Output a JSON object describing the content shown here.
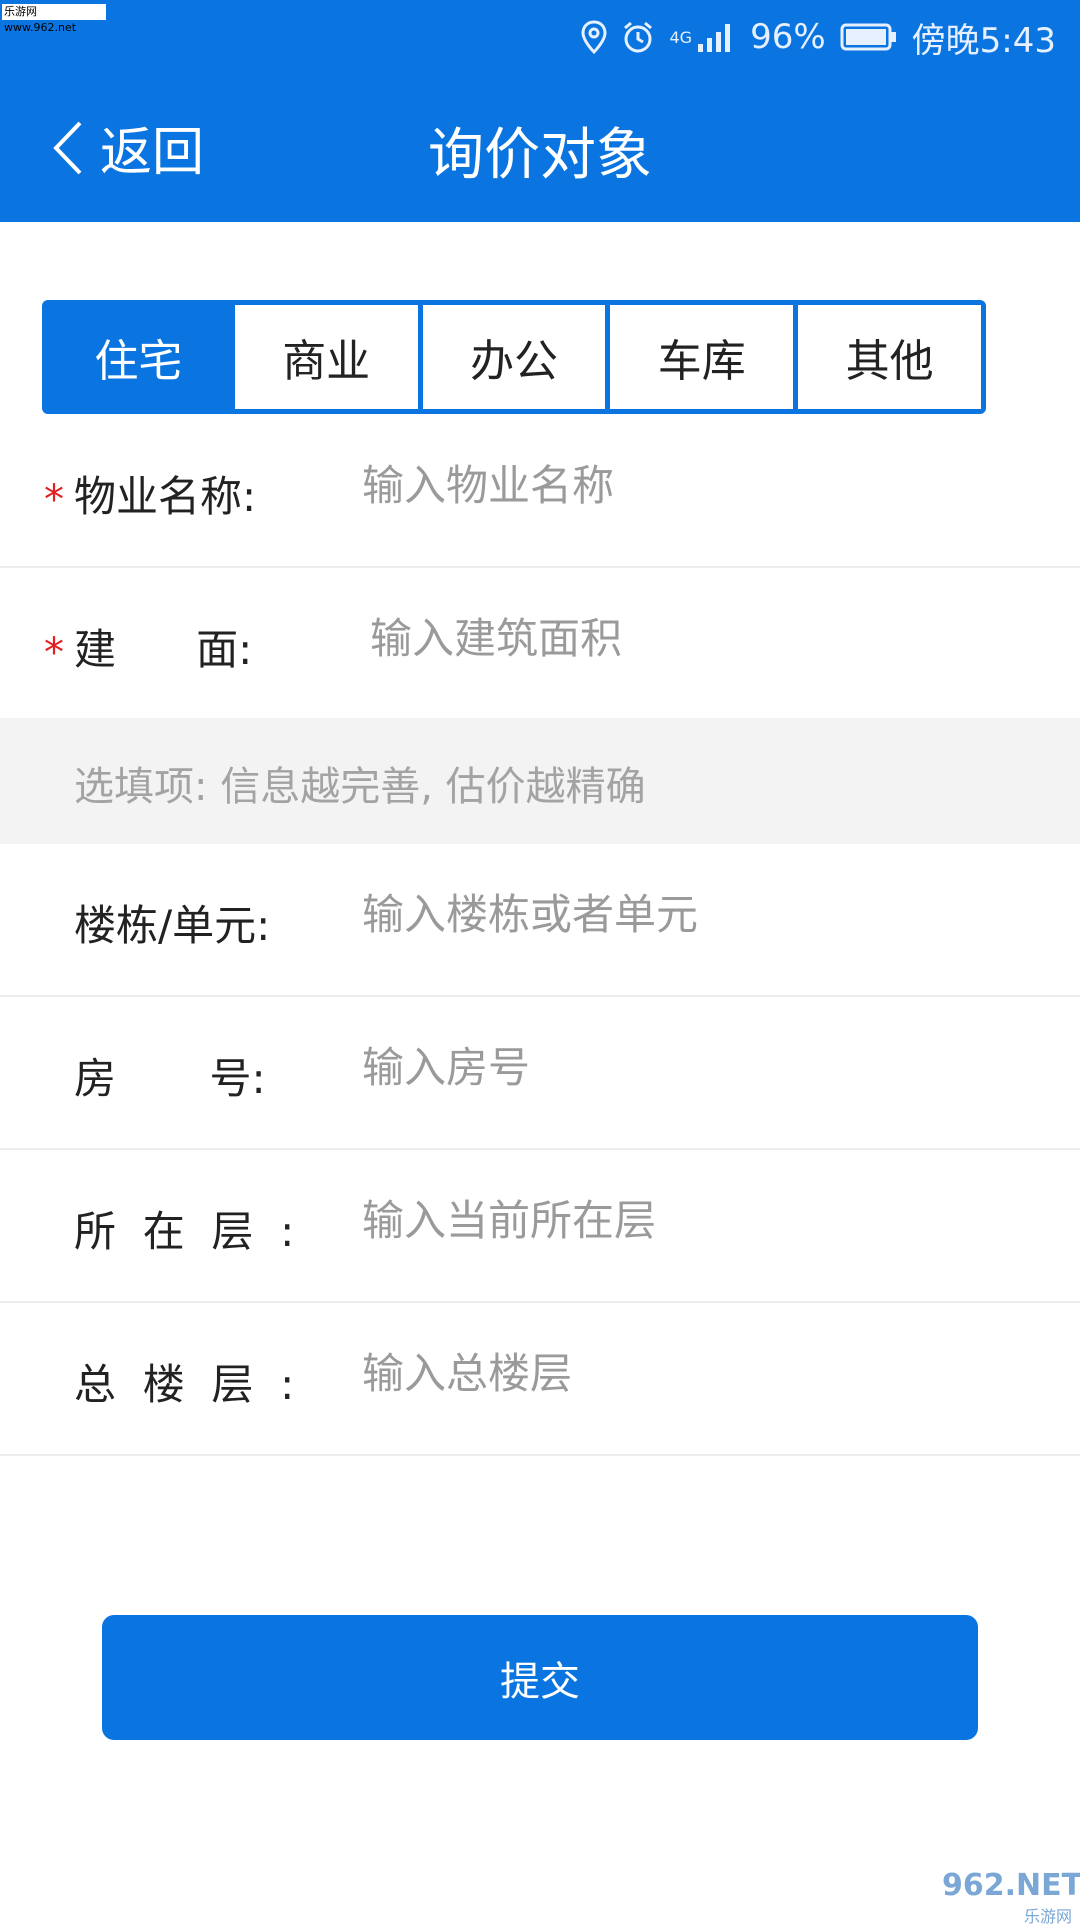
{
  "watermark_top": "乐游网 www.962.net",
  "status": {
    "battery": "96%",
    "time": "傍晚5:43",
    "network": "4G"
  },
  "header": {
    "back_label": "返回",
    "title": "询价对象"
  },
  "tabs": [
    {
      "label": "住宅",
      "active": true
    },
    {
      "label": "商业",
      "active": false
    },
    {
      "label": "办公",
      "active": false
    },
    {
      "label": "车库",
      "active": false
    },
    {
      "label": "其他",
      "active": false
    }
  ],
  "form": {
    "required_mark": "*",
    "property_name": {
      "label": "物业名称:",
      "placeholder": "输入物业名称"
    },
    "area": {
      "label": "建      面:",
      "placeholder": "输入建筑面积"
    },
    "optional_note": "选填项: 信息越完善, 估价越精确",
    "building_unit": {
      "label": "楼栋/单元:",
      "placeholder": "输入楼栋或者单元"
    },
    "room_no": {
      "label": "房       号:",
      "placeholder": "输入房号"
    },
    "floor": {
      "label": "所  在  层  :",
      "placeholder": "输入当前所在层"
    },
    "total_floors": {
      "label": "总  楼  层  :",
      "placeholder": "输入总楼层"
    }
  },
  "submit_label": "提交",
  "watermark_bottom": {
    "main": "962.NET",
    "sub": "乐游网"
  },
  "colors": {
    "primary": "#0a74e0",
    "required": "#e02020"
  }
}
